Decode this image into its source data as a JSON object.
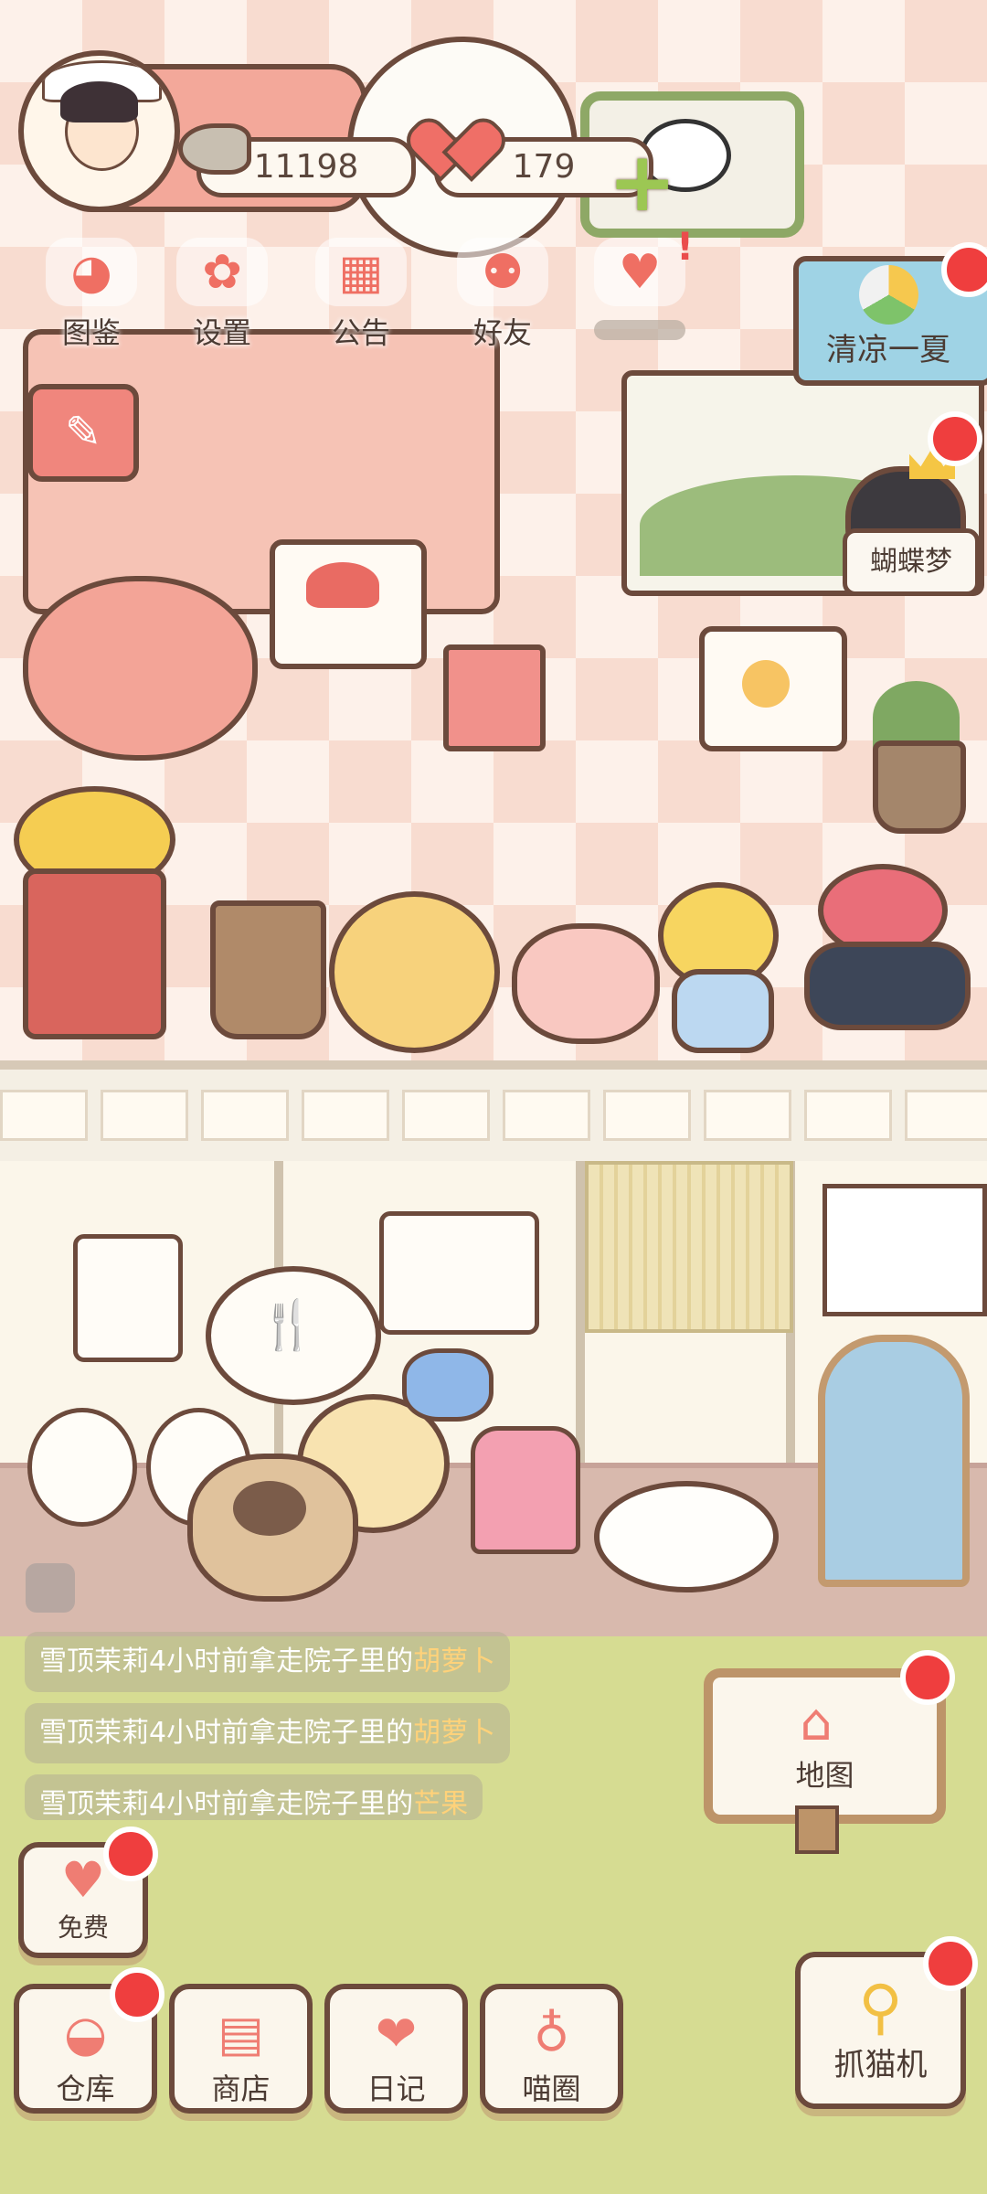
{
  "currency": {
    "fish": "11198",
    "hearts": "179"
  },
  "top_menu": [
    {
      "label": "图鉴",
      "icon": "cat-face-icon"
    },
    {
      "label": "设置",
      "icon": "gear-icon"
    },
    {
      "label": "公告",
      "icon": "gift-icon"
    },
    {
      "label": "好友",
      "icon": "friends-icon"
    },
    {
      "label": "",
      "icon": "message-hearts-icon"
    }
  ],
  "event": {
    "label": "清凉一夏"
  },
  "butterfly_label": "蝴蝶梦",
  "notifications": [
    {
      "text": "雪顶茉莉4小时前拿走院子里的",
      "item": "胡萝卜"
    },
    {
      "text": "雪顶茉莉4小时前拿走院子里的",
      "item": "胡萝卜"
    },
    {
      "text": "雪顶茉莉4小时前拿走院子里的",
      "item": "芒果"
    }
  ],
  "map": {
    "label": "地图"
  },
  "free": {
    "label": "免费"
  },
  "bottom_bar": [
    {
      "label": "仓库",
      "icon": "storage-icon"
    },
    {
      "label": "商店",
      "icon": "shop-icon"
    },
    {
      "label": "日记",
      "icon": "diary-icon"
    },
    {
      "label": "喵圈",
      "icon": "cat-planet-icon"
    }
  ],
  "claw": {
    "label": "抓猫机"
  },
  "colors": {
    "accent": "#ef6f67",
    "badge": "#ef3e3e",
    "outline": "#6c4a3c",
    "yard": "#d6dc92"
  }
}
